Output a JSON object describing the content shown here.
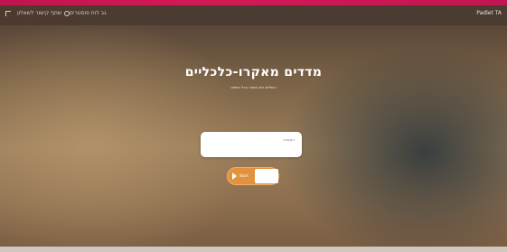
{
  "topbar": {
    "brand": "Padlet TA",
    "copy_link_label": "שתף קישור לשאלון",
    "back_label": "גב לוח פוסטרים"
  },
  "main": {
    "title": "מדדים מאקרו-כלכליים",
    "subtitle": "השלימו את השאר בכל משפט",
    "search_placeholder": "הקשיבו",
    "start_label": "Start"
  },
  "colors": {
    "accent_stripe": "#c0144f",
    "start_button": "#e2913e"
  }
}
